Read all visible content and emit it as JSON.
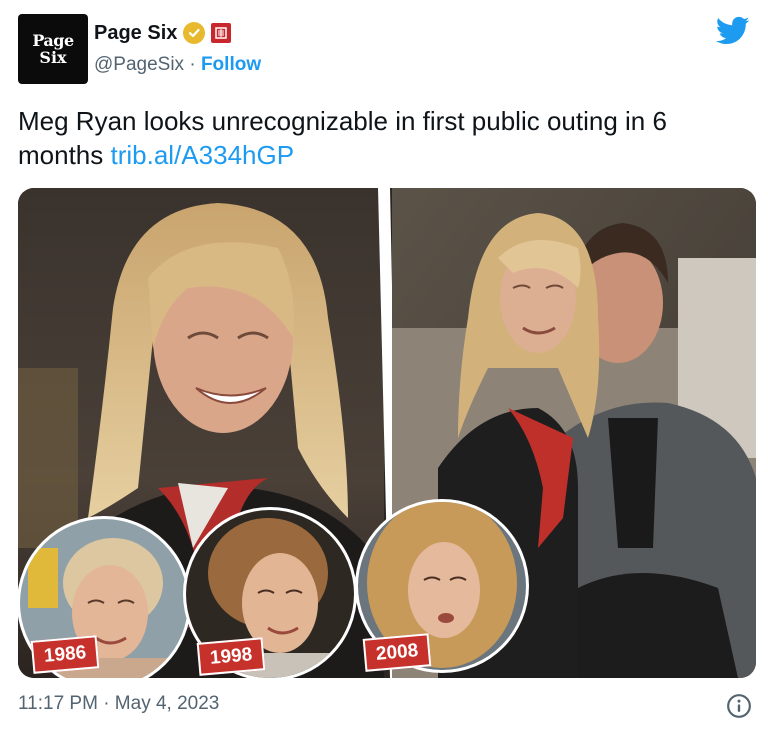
{
  "account": {
    "avatar_line1": "Page",
    "avatar_line2": "Six",
    "name": "Page Six",
    "handle": "@PageSix",
    "separator": "·",
    "follow_label": "Follow"
  },
  "tweet": {
    "text": "Meg Ryan looks unrecognizable in first public outing in 6 months ",
    "link": "trib.al/A334hGP"
  },
  "media": {
    "badges": [
      "1986",
      "1998",
      "2008"
    ]
  },
  "footer": {
    "timestamp": "11:17 PM · May 4, 2023"
  },
  "colors": {
    "link": "#1d9bf0",
    "badge": "#c7312b",
    "verified": "#e8b92e"
  },
  "icons": [
    "verified-badge-icon",
    "affiliate-badge-icon",
    "twitter-bird-icon",
    "info-icon"
  ]
}
